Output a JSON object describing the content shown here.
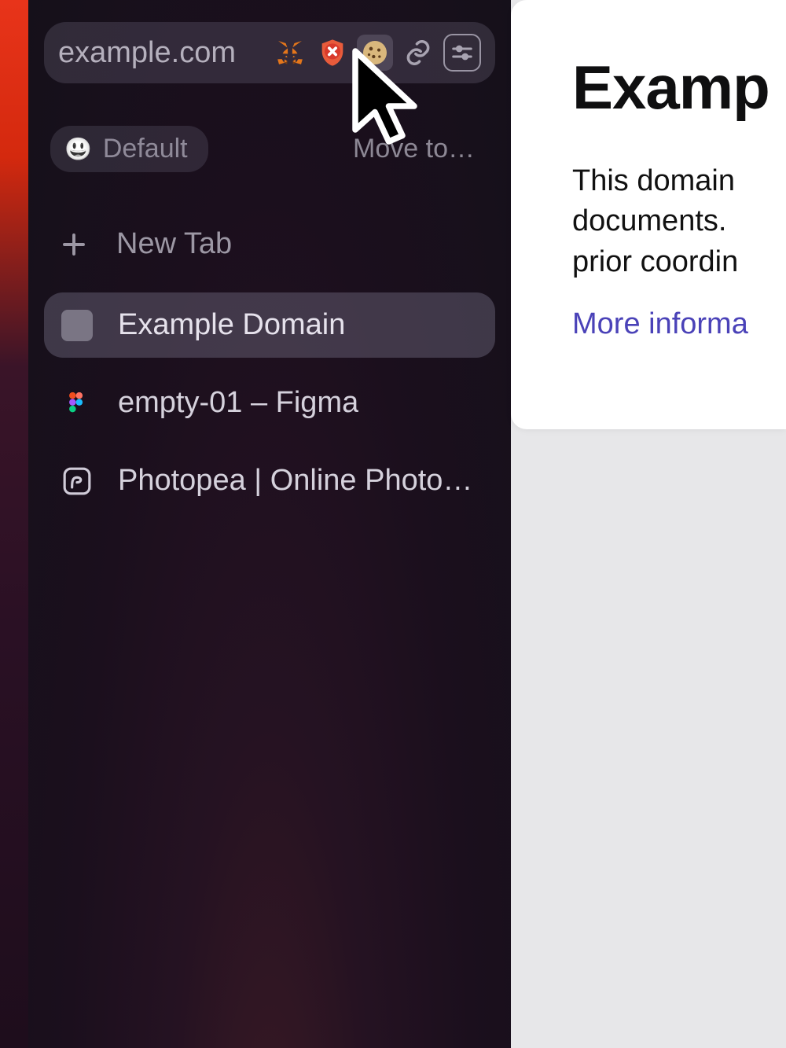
{
  "sidebar": {
    "url": "example.com",
    "extensions": [
      {
        "name": "metamask",
        "iconName": "fox-icon"
      },
      {
        "name": "blocker",
        "iconName": "shield-x-icon"
      },
      {
        "name": "cookies",
        "iconName": "cookie-icon"
      },
      {
        "name": "copy-link",
        "iconName": "link-icon"
      },
      {
        "name": "site-settings",
        "iconName": "sliders-icon"
      }
    ],
    "space": {
      "emoji": "😃",
      "label": "Default"
    },
    "moveTo": "Move to…",
    "newTab": "New Tab",
    "tabs": [
      {
        "title": "Example Domain",
        "active": true,
        "favicon": "blank"
      },
      {
        "title": "empty-01 – Figma",
        "active": false,
        "favicon": "figma"
      },
      {
        "title": "Photopea | Online Photo Ed…",
        "active": false,
        "favicon": "photopea"
      }
    ]
  },
  "content": {
    "heading": "Examp",
    "line1": "This domain ",
    "line2": "documents. ",
    "line3": "prior coordin",
    "link": "More informa"
  }
}
